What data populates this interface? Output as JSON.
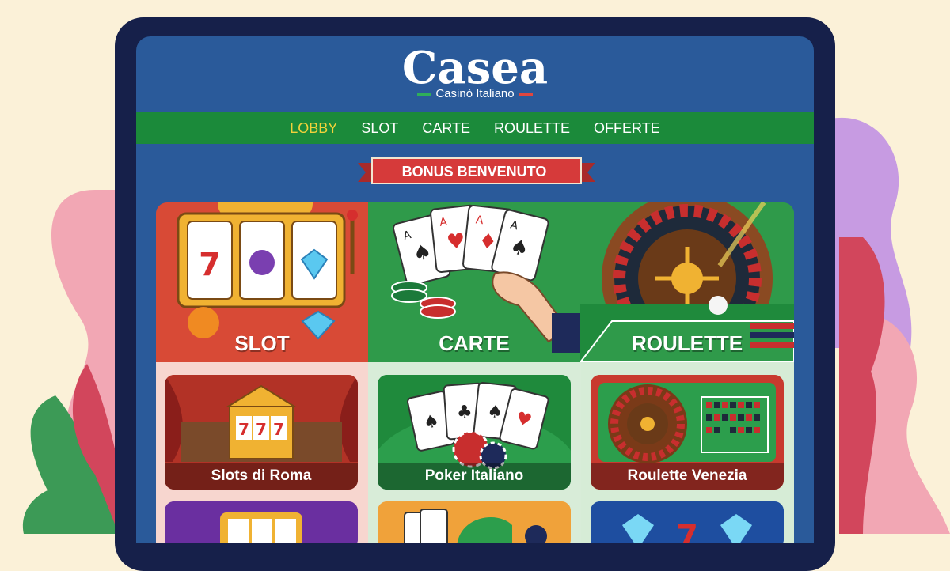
{
  "brand": {
    "name": "Casea",
    "tagline": "Casinò Italiano"
  },
  "nav": {
    "items": [
      {
        "label": "LOBBY",
        "active": true
      },
      {
        "label": "SLOT",
        "active": false
      },
      {
        "label": "CARTE",
        "active": false
      },
      {
        "label": "ROULETTE",
        "active": false
      },
      {
        "label": "OFFERTE",
        "active": false
      }
    ]
  },
  "banner": {
    "label": "BONUS BENVENUTO"
  },
  "categories": [
    {
      "label": "SLOT",
      "color": "#d84a36"
    },
    {
      "label": "CARTE",
      "color": "#2f9a4a"
    },
    {
      "label": "ROULETTE",
      "color": "#2f9a4a"
    }
  ],
  "games": [
    {
      "label": "Slots di Roma"
    },
    {
      "label": "Poker Italiano"
    },
    {
      "label": "Roulette Venezia"
    }
  ],
  "colors": {
    "tablet_frame": "#16204a",
    "screen_bg": "#2a5a9a",
    "nav_bg": "#1b8a3a",
    "nav_active": "#f2d23a",
    "ribbon": "#d63a3a"
  },
  "icons": [
    "slot-machine-icon",
    "playing-cards-icon",
    "roulette-wheel-icon"
  ]
}
